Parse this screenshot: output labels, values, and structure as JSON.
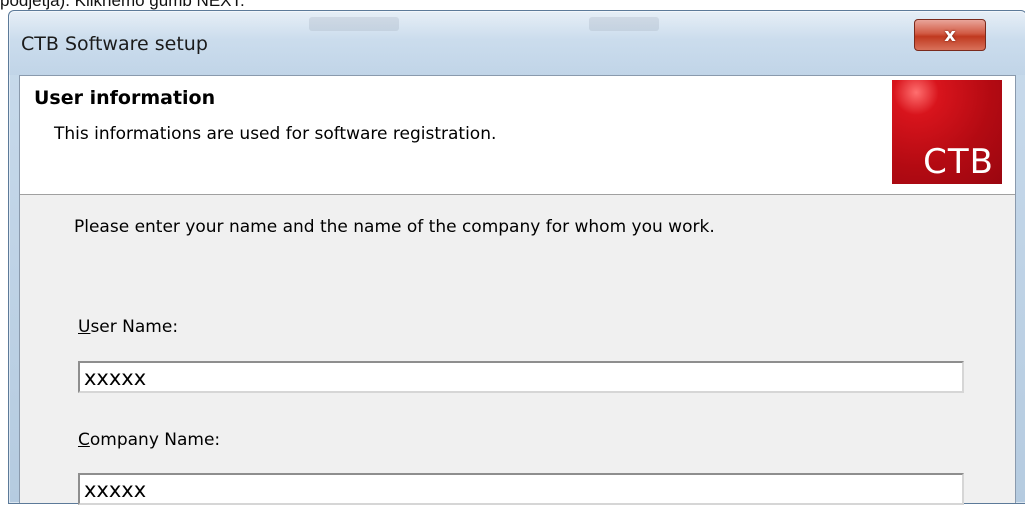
{
  "document_text": "podjetja). Kliknemo gumb NEXT.",
  "window": {
    "title": "CTB Software setup",
    "close_symbol": "x"
  },
  "header": {
    "title": "User information",
    "subtitle": "This informations are used for software registration.",
    "logo_text": "CTB",
    "logo_color": "#c0101a"
  },
  "form": {
    "instructions": "Please enter your name and the name of the company for whom you work.",
    "user_name_label_mnemonic": "U",
    "user_name_label_rest": "ser Name:",
    "user_name_value": "xxxxx",
    "company_label_mnemonic": "C",
    "company_label_rest": "ompany Name:",
    "company_value": "xxxxx"
  }
}
